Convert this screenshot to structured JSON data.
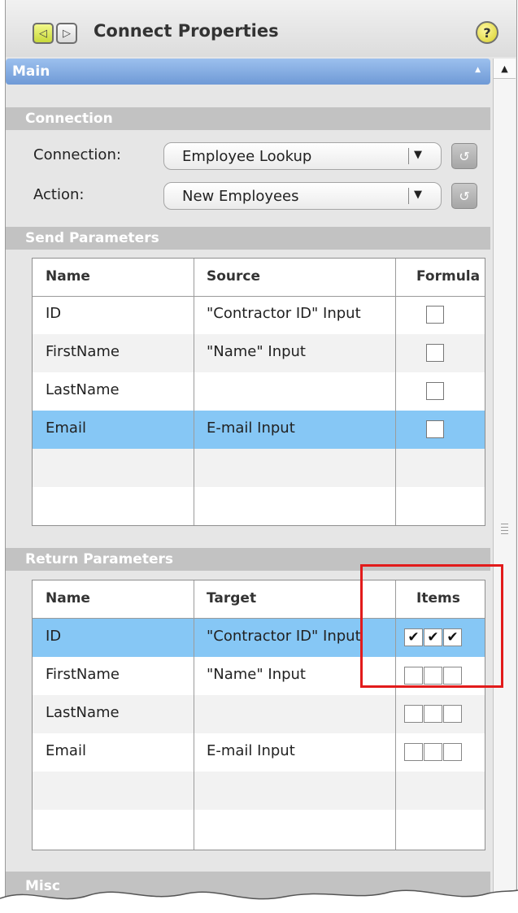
{
  "window": {
    "title": "Connect Properties",
    "back_icon": "◁",
    "forward_icon": "▷",
    "help_icon": "?"
  },
  "main_section": {
    "label": "Main",
    "collapse_icon": "▲"
  },
  "scrollbar": {
    "up_icon": "▲"
  },
  "connection_section": {
    "header": "Connection",
    "connection_label": "Connection:",
    "connection_value": "Employee Lookup",
    "action_label": "Action:",
    "action_value": "New Employees",
    "dropdown_caret": "▼",
    "refresh_icon": "↺"
  },
  "send_parameters": {
    "header": "Send Parameters",
    "columns": [
      "Name",
      "Source",
      "Formula"
    ],
    "rows": [
      {
        "name": "ID",
        "source": "\"Contractor ID\" Input",
        "formula": false
      },
      {
        "name": "FirstName",
        "source": "\"Name\" Input",
        "formula": false
      },
      {
        "name": "LastName",
        "source": "",
        "formula": false
      },
      {
        "name": "Email",
        "source": "E-mail Input",
        "formula": false,
        "selected": true
      }
    ]
  },
  "return_parameters": {
    "header": "Return Parameters",
    "columns": [
      "Name",
      "Target",
      "Items"
    ],
    "rows": [
      {
        "name": "ID",
        "target": "\"Contractor ID\" Input",
        "items": [
          true,
          true,
          true
        ],
        "selected": true
      },
      {
        "name": "FirstName",
        "target": "\"Name\" Input",
        "items": [
          false,
          false,
          false
        ]
      },
      {
        "name": "LastName",
        "target": "",
        "items": [
          false,
          false,
          false
        ]
      },
      {
        "name": "Email",
        "target": "E-mail Input",
        "items": [
          false,
          false,
          false
        ]
      }
    ]
  },
  "misc_section": {
    "header": "Misc"
  },
  "colors": {
    "main_header": "#7fa7de",
    "selected_row": "#86c7f5",
    "highlight_box": "#e21b1b"
  }
}
